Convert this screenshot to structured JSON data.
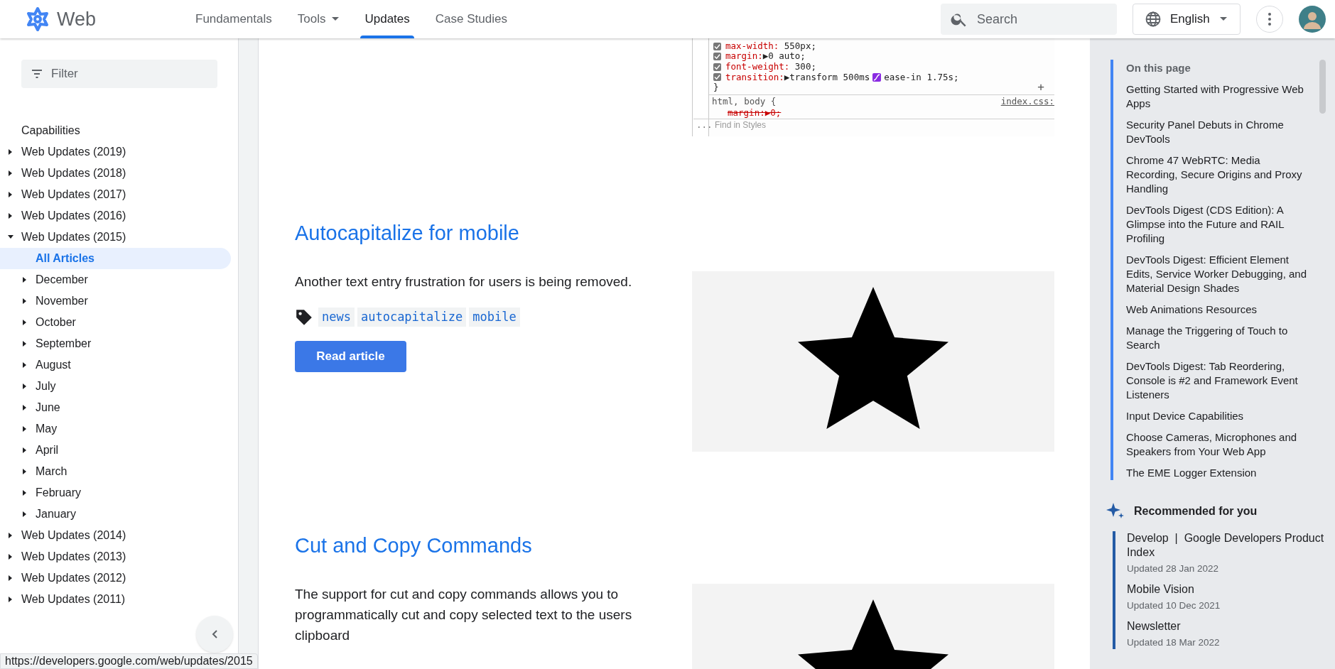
{
  "header": {
    "site_name": "Web",
    "nav": [
      {
        "label": "Fundamentals",
        "selected": false,
        "has_menu": false
      },
      {
        "label": "Tools",
        "selected": false,
        "has_menu": true
      },
      {
        "label": "Updates",
        "selected": true,
        "has_menu": false
      },
      {
        "label": "Case Studies",
        "selected": false,
        "has_menu": false
      }
    ],
    "search": {
      "placeholder": "Search"
    },
    "language": "English"
  },
  "sidebar": {
    "filter": {
      "placeholder": "Filter"
    },
    "items": [
      {
        "label": "Capabilities"
      },
      {
        "label": "Web Updates (2019)",
        "expanded": false
      },
      {
        "label": "Web Updates (2018)",
        "expanded": false
      },
      {
        "label": "Web Updates (2017)",
        "expanded": false
      },
      {
        "label": "Web Updates (2016)",
        "expanded": false
      },
      {
        "label": "Web Updates (2015)",
        "expanded": true,
        "children": [
          {
            "label": "All Articles",
            "selected": true
          },
          {
            "label": "December",
            "expanded": false
          },
          {
            "label": "November",
            "expanded": false
          },
          {
            "label": "October",
            "expanded": false
          },
          {
            "label": "September",
            "expanded": false
          },
          {
            "label": "August",
            "expanded": false
          },
          {
            "label": "July",
            "expanded": false
          },
          {
            "label": "June",
            "expanded": false
          },
          {
            "label": "May",
            "expanded": false
          },
          {
            "label": "April",
            "expanded": false
          },
          {
            "label": "March",
            "expanded": false
          },
          {
            "label": "February",
            "expanded": false
          },
          {
            "label": "January",
            "expanded": false
          }
        ]
      },
      {
        "label": "Web Updates (2014)",
        "expanded": false
      },
      {
        "label": "Web Updates (2013)",
        "expanded": false
      },
      {
        "label": "Web Updates (2012)",
        "expanded": false
      },
      {
        "label": "Web Updates (2011)",
        "expanded": false
      }
    ]
  },
  "code_panel": {
    "lines": [
      {
        "kind": "decl",
        "checked": true,
        "property": "max-width:",
        "value": " 550px;"
      },
      {
        "kind": "decl",
        "checked": true,
        "property": "margin:",
        "value": "▶0 auto;"
      },
      {
        "kind": "decl",
        "checked": true,
        "property": "font-weight:",
        "value": " 300;"
      },
      {
        "kind": "decl",
        "checked": true,
        "property": "transition:",
        "value": "▶transform 500ms",
        "value_after_icon": "ease-in 1.75s;"
      },
      {
        "kind": "close",
        "text": "}",
        "add": "+"
      },
      {
        "kind": "selector",
        "text": "html, body {",
        "source": "index.css:"
      },
      {
        "kind": "struck",
        "text": "margin:▶0;"
      },
      {
        "kind": "find",
        "more": "...",
        "placeholder": "Find in Styles"
      }
    ]
  },
  "articles": [
    {
      "title": "Autocapitalize for mobile",
      "summary": "Another text entry frustration for users is being removed.",
      "tags": [
        "news",
        "autocapitalize",
        "mobile"
      ],
      "button": "Read article"
    },
    {
      "title": "Cut and Copy Commands",
      "summary": "The support for cut and copy commands allows you to programmatically cut and copy selected text to the users clipboard"
    }
  ],
  "toc": {
    "title": "On this page",
    "items": [
      "Getting Started with Progressive Web Apps",
      "Security Panel Debuts in Chrome DevTools",
      "Chrome 47 WebRTC: Media Recording, Secure Origins and Proxy Handling",
      "DevTools Digest (CDS Edition): A Glimpse into the Future and RAIL Profiling",
      "DevTools Digest: Efficient Element Edits, Service Worker Debugging, and Material Design Shades",
      "Web Animations Resources",
      "Manage the Triggering of Touch to Search",
      "DevTools Digest: Tab Reordering, Console is #2 and Framework Event Listeners",
      "Input Device Capabilities",
      "Choose Cameras, Microphones and Speakers from Your Web App",
      "The EME Logger Extension"
    ]
  },
  "recommended": {
    "title": "Recommended for you",
    "items": [
      {
        "title": "Develop  |  Google Developers Product Index",
        "updated": "Updated 28 Jan 2022"
      },
      {
        "title": "Mobile Vision",
        "updated": "Updated 10 Dec 2021"
      },
      {
        "title": "Newsletter",
        "updated": "Updated 18 Mar 2022"
      }
    ]
  },
  "status_url": "https://developers.google.com/web/updates/2015"
}
